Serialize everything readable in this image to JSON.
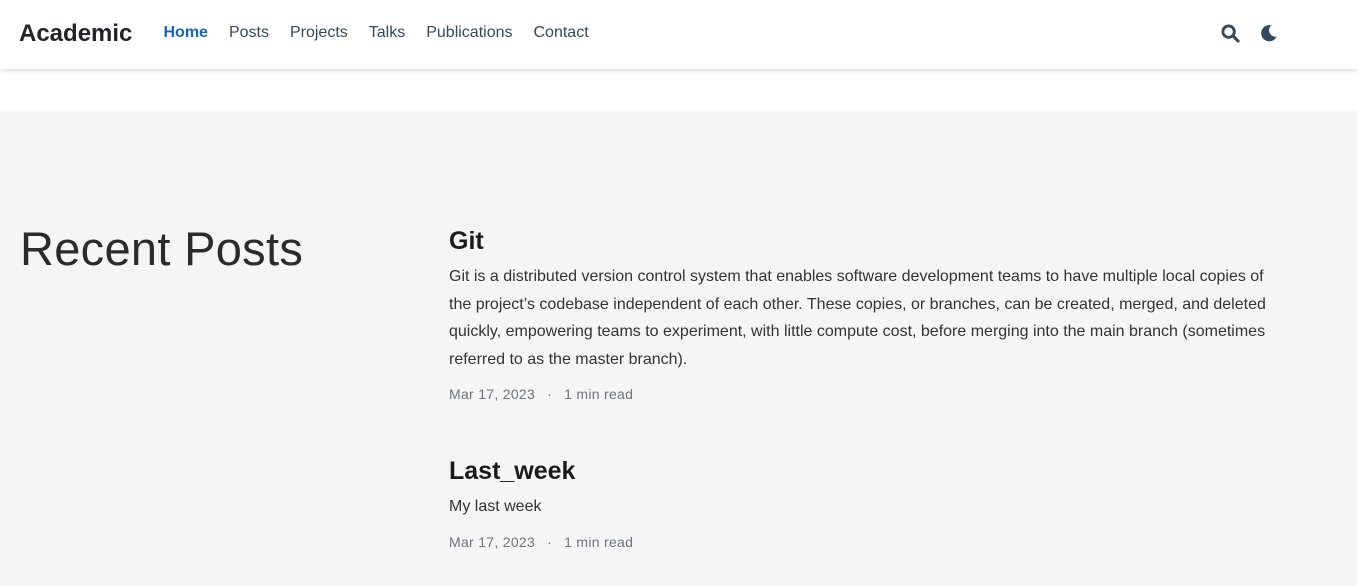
{
  "navbar": {
    "brand": "Academic",
    "links": [
      {
        "label": "Home",
        "active": true
      },
      {
        "label": "Posts",
        "active": false
      },
      {
        "label": "Projects",
        "active": false
      },
      {
        "label": "Talks",
        "active": false
      },
      {
        "label": "Publications",
        "active": false
      },
      {
        "label": "Contact",
        "active": false
      }
    ],
    "icons": [
      "search-icon",
      "moon-icon"
    ]
  },
  "colors": {
    "accent": "#1565c0",
    "page_bg": "#f5f5f5",
    "text": "#212529",
    "meta": "#6c757d"
  },
  "section": {
    "title": "Recent Posts"
  },
  "posts": [
    {
      "title": "Git",
      "summary": "Git is a distributed version control system that enables software development teams to have multiple local copies of the project’s codebase independent of each other. These copies, or branches, can be created, merged, and deleted quickly, empowering teams to experiment, with little compute cost, before merging into the main branch (sometimes referred to as the master branch).",
      "date": "Mar 17, 2023",
      "separator": "·",
      "read_time": "1 min read"
    },
    {
      "title": "Last_week",
      "summary": "My last week",
      "date": "Mar 17, 2023",
      "separator": "·",
      "read_time": "1 min read"
    }
  ]
}
